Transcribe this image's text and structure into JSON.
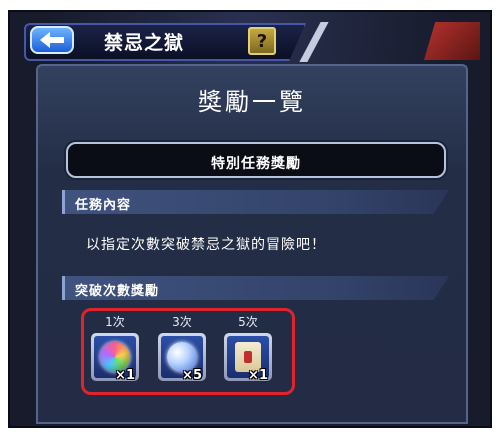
{
  "header": {
    "stage_title": "禁忌之獄",
    "help_glyph": "?"
  },
  "panel": {
    "title": "獎勵一覽",
    "special_mission_label": "特別任務獎勵",
    "mission_header": "任務內容",
    "mission_description": "以指定次數突破禁忌之獄的冒險吧！",
    "rewards_header": "突破次數獎勵"
  },
  "rewards": [
    {
      "count_label": "1次",
      "icon": "rainbow-orb-icon",
      "quantity": "×1"
    },
    {
      "count_label": "3次",
      "icon": "blue-orb-icon",
      "quantity": "×5"
    },
    {
      "count_label": "5次",
      "icon": "scroll-icon",
      "quantity": "×1"
    }
  ],
  "colors": {
    "highlight_border": "#e0242b",
    "back_button": "#1a5fd6"
  }
}
